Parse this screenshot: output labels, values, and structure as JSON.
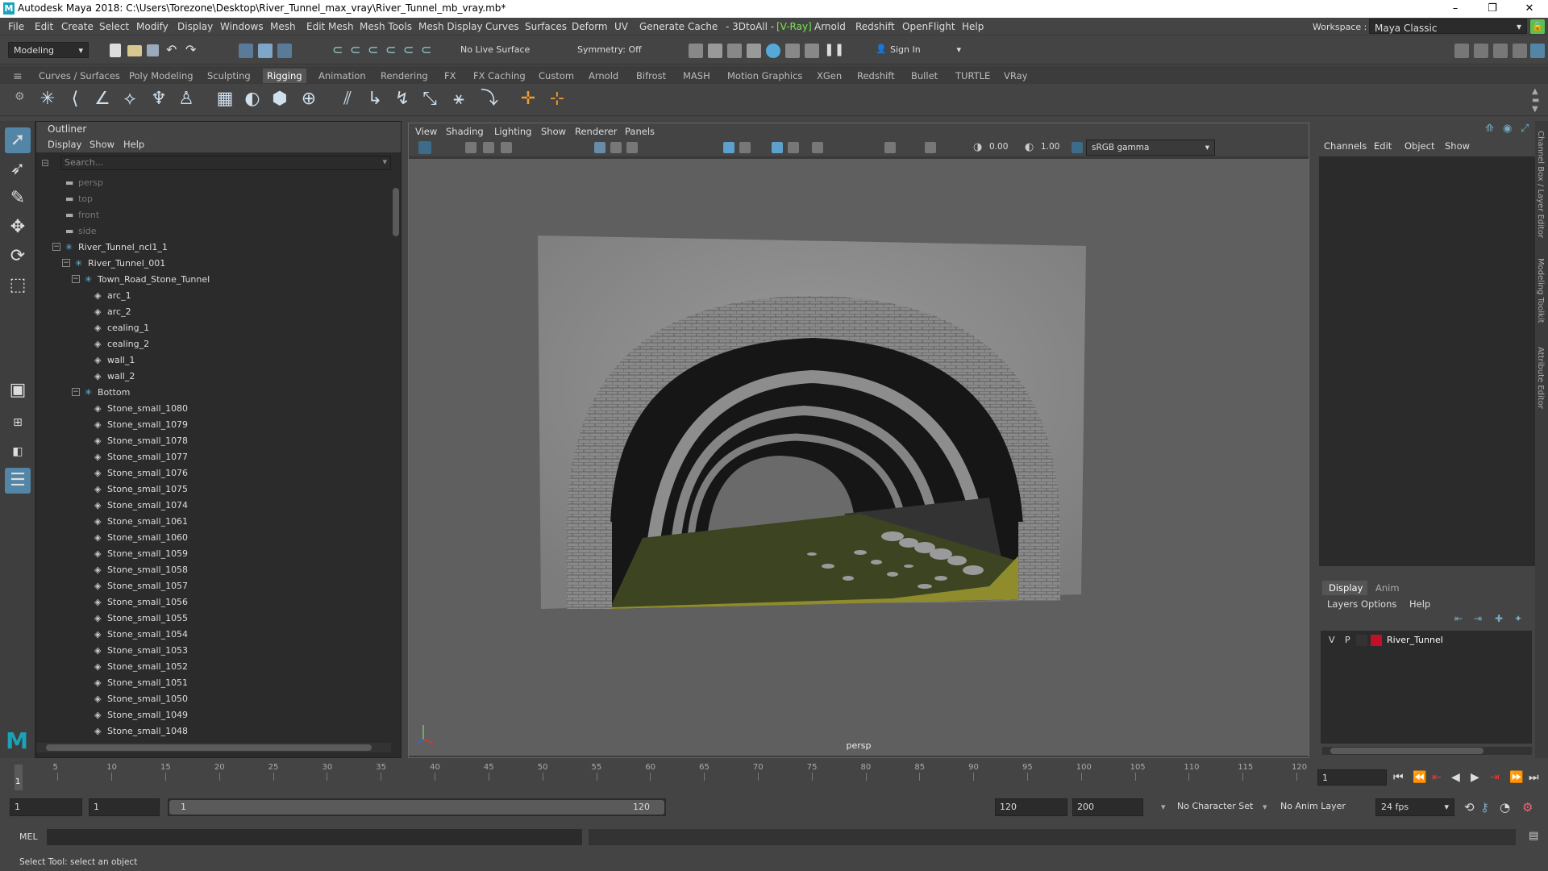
{
  "window": {
    "title": "Autodesk Maya 2018: C:\\Users\\Torezone\\Desktop\\River_Tunnel_max_vray\\River_Tunnel_mb_vray.mb*",
    "minimize": "–",
    "maximize": "❐",
    "close": "✕"
  },
  "menubar": {
    "items": [
      "File",
      "Edit",
      "Create",
      "Select",
      "Modify",
      "Display",
      "Windows",
      "Mesh",
      "Edit Mesh",
      "Mesh Tools",
      "Mesh Display",
      "Curves",
      "Surfaces",
      "Deform",
      "UV",
      "Generate",
      "Cache",
      "- 3DtoAll -",
      "[V-Ray]",
      "Arnold",
      "Redshift",
      "OpenFlight",
      "Help"
    ],
    "workspace_label": "Workspace :",
    "workspace_value": "Maya Classic"
  },
  "statusline": {
    "mode": "Modeling",
    "live_surface": "No Live Surface",
    "symmetry": "Symmetry: Off",
    "sign_in": "Sign In"
  },
  "shelf": {
    "tabs": [
      "Curves / Surfaces",
      "Poly Modeling",
      "Sculpting",
      "Rigging",
      "Animation",
      "Rendering",
      "FX",
      "FX Caching",
      "Custom",
      "Arnold",
      "Bifrost",
      "MASH",
      "Motion Graphics",
      "XGen",
      "Redshift",
      "Bullet",
      "TURTLE",
      "VRay"
    ],
    "active_tab": "Rigging"
  },
  "outliner": {
    "title": "Outliner",
    "menu": [
      "Display",
      "Show",
      "Help"
    ],
    "search_placeholder": "Search...",
    "rows": [
      {
        "label": "persp",
        "depth": 0,
        "type": "camera",
        "dim": true,
        "toggle": ""
      },
      {
        "label": "top",
        "depth": 0,
        "type": "camera",
        "dim": true,
        "toggle": ""
      },
      {
        "label": "front",
        "depth": 0,
        "type": "camera",
        "dim": true,
        "toggle": ""
      },
      {
        "label": "side",
        "depth": 0,
        "type": "camera",
        "dim": true,
        "toggle": ""
      },
      {
        "label": "River_Tunnel_ncl1_1",
        "depth": 0,
        "type": "group",
        "dim": false,
        "toggle": "−"
      },
      {
        "label": "River_Tunnel_001",
        "depth": 1,
        "type": "group",
        "dim": false,
        "toggle": "−"
      },
      {
        "label": "Town_Road_Stone_Tunnel",
        "depth": 2,
        "type": "group",
        "dim": false,
        "toggle": "−"
      },
      {
        "label": "arc_1",
        "depth": 3,
        "type": "mesh",
        "dim": false,
        "toggle": ""
      },
      {
        "label": "arc_2",
        "depth": 3,
        "type": "mesh",
        "dim": false,
        "toggle": ""
      },
      {
        "label": "cealing_1",
        "depth": 3,
        "type": "mesh",
        "dim": false,
        "toggle": ""
      },
      {
        "label": "cealing_2",
        "depth": 3,
        "type": "mesh",
        "dim": false,
        "toggle": ""
      },
      {
        "label": "wall_1",
        "depth": 3,
        "type": "mesh",
        "dim": false,
        "toggle": ""
      },
      {
        "label": "wall_2",
        "depth": 3,
        "type": "mesh",
        "dim": false,
        "toggle": ""
      },
      {
        "label": "Bottom",
        "depth": 2,
        "type": "group",
        "dim": false,
        "toggle": "−"
      },
      {
        "label": "Stone_small_1080",
        "depth": 3,
        "type": "mesh",
        "dim": false,
        "toggle": ""
      },
      {
        "label": "Stone_small_1079",
        "depth": 3,
        "type": "mesh",
        "dim": false,
        "toggle": ""
      },
      {
        "label": "Stone_small_1078",
        "depth": 3,
        "type": "mesh",
        "dim": false,
        "toggle": ""
      },
      {
        "label": "Stone_small_1077",
        "depth": 3,
        "type": "mesh",
        "dim": false,
        "toggle": ""
      },
      {
        "label": "Stone_small_1076",
        "depth": 3,
        "type": "mesh",
        "dim": false,
        "toggle": ""
      },
      {
        "label": "Stone_small_1075",
        "depth": 3,
        "type": "mesh",
        "dim": false,
        "toggle": ""
      },
      {
        "label": "Stone_small_1074",
        "depth": 3,
        "type": "mesh",
        "dim": false,
        "toggle": ""
      },
      {
        "label": "Stone_small_1061",
        "depth": 3,
        "type": "mesh",
        "dim": false,
        "toggle": ""
      },
      {
        "label": "Stone_small_1060",
        "depth": 3,
        "type": "mesh",
        "dim": false,
        "toggle": ""
      },
      {
        "label": "Stone_small_1059",
        "depth": 3,
        "type": "mesh",
        "dim": false,
        "toggle": ""
      },
      {
        "label": "Stone_small_1058",
        "depth": 3,
        "type": "mesh",
        "dim": false,
        "toggle": ""
      },
      {
        "label": "Stone_small_1057",
        "depth": 3,
        "type": "mesh",
        "dim": false,
        "toggle": ""
      },
      {
        "label": "Stone_small_1056",
        "depth": 3,
        "type": "mesh",
        "dim": false,
        "toggle": ""
      },
      {
        "label": "Stone_small_1055",
        "depth": 3,
        "type": "mesh",
        "dim": false,
        "toggle": ""
      },
      {
        "label": "Stone_small_1054",
        "depth": 3,
        "type": "mesh",
        "dim": false,
        "toggle": ""
      },
      {
        "label": "Stone_small_1053",
        "depth": 3,
        "type": "mesh",
        "dim": false,
        "toggle": ""
      },
      {
        "label": "Stone_small_1052",
        "depth": 3,
        "type": "mesh",
        "dim": false,
        "toggle": ""
      },
      {
        "label": "Stone_small_1051",
        "depth": 3,
        "type": "mesh",
        "dim": false,
        "toggle": ""
      },
      {
        "label": "Stone_small_1050",
        "depth": 3,
        "type": "mesh",
        "dim": false,
        "toggle": ""
      },
      {
        "label": "Stone_small_1049",
        "depth": 3,
        "type": "mesh",
        "dim": false,
        "toggle": ""
      },
      {
        "label": "Stone_small_1048",
        "depth": 3,
        "type": "mesh",
        "dim": false,
        "toggle": ""
      }
    ]
  },
  "viewport": {
    "menu": [
      "View",
      "Shading",
      "Lighting",
      "Show",
      "Renderer",
      "Panels"
    ],
    "exposure": "0.00",
    "gamma": "1.00",
    "color_space": "sRGB gamma",
    "camera_label": "persp"
  },
  "channelbox": {
    "menu": [
      "Channels",
      "Edit",
      "Object",
      "Show"
    ]
  },
  "layers": {
    "tabs": [
      "Display",
      "Anim"
    ],
    "menu": [
      "Layers",
      "Options",
      "Help"
    ],
    "layer_v": "V",
    "layer_p": "P",
    "layer_name": "River_Tunnel",
    "layer_color": "#c0102a"
  },
  "side_tabs": [
    "Channel Box / Layer Editor",
    "Modeling Toolkit",
    "Attribute Editor"
  ],
  "timeline": {
    "ticks": [
      "5",
      "10",
      "15",
      "20",
      "25",
      "30",
      "35",
      "40",
      "45",
      "50",
      "55",
      "60",
      "65",
      "70",
      "75",
      "80",
      "85",
      "90",
      "95",
      "100",
      "105",
      "110",
      "115",
      "120"
    ],
    "current_frame_marker": "1",
    "current_frame": "1"
  },
  "range": {
    "start": "1",
    "playback_start": "1",
    "slider_start": "1",
    "slider_end": "120",
    "playback_end": "120",
    "end": "200",
    "character_set": "No Character Set",
    "anim_layer": "No Anim Layer",
    "fps": "24 fps"
  },
  "command": {
    "lang": "MEL"
  },
  "help_line": "Select Tool: select an object",
  "colors": {
    "accent": "#5285a6",
    "vray_green": "#78e64e"
  }
}
